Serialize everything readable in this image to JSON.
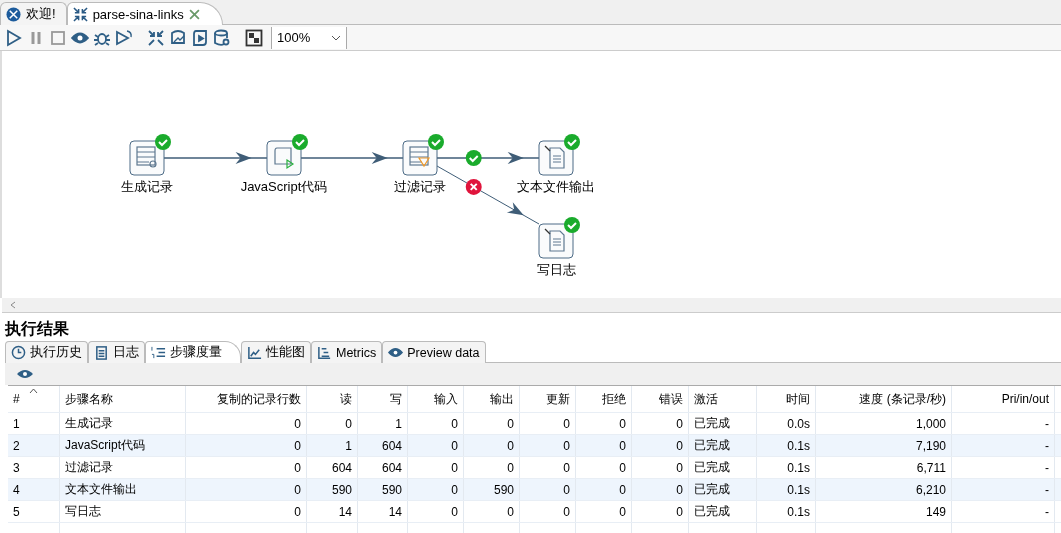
{
  "editor_tabs": [
    {
      "label": "欢迎!",
      "selected": false,
      "closable": false
    },
    {
      "label": "parse-sina-links",
      "selected": true,
      "closable": true
    }
  ],
  "toolbar": {
    "zoom": "100%"
  },
  "canvas": {
    "steps": [
      {
        "label": "生成记录",
        "finished": true
      },
      {
        "label": "JavaScript代码",
        "finished": true
      },
      {
        "label": "过滤记录",
        "finished": true
      },
      {
        "label": "文本文件输出",
        "finished": true
      },
      {
        "label": "写日志",
        "finished": true
      }
    ],
    "hops": [
      {
        "success": false,
        "error": false
      },
      {
        "success": false,
        "error": false
      },
      {
        "success": true,
        "error": false
      },
      {
        "success": false,
        "error": true
      }
    ]
  },
  "results": {
    "title": "执行结果",
    "tabs": [
      {
        "label": "执行历史",
        "selected": false
      },
      {
        "label": "日志",
        "selected": false
      },
      {
        "label": "步骤度量",
        "selected": true
      },
      {
        "label": "性能图",
        "selected": false
      },
      {
        "label": "Metrics",
        "selected": false
      },
      {
        "label": "Preview data",
        "selected": false
      }
    ],
    "table": {
      "columns": [
        {
          "label": "#",
          "sorted": true
        },
        {
          "label": "步骤名称",
          "sorted": false
        },
        {
          "label": "复制的记录行数",
          "sorted": false
        },
        {
          "label": "读",
          "sorted": false
        },
        {
          "label": "写",
          "sorted": false
        },
        {
          "label": "输入",
          "sorted": false
        },
        {
          "label": "输出",
          "sorted": false
        },
        {
          "label": "更新",
          "sorted": false
        },
        {
          "label": "拒绝",
          "sorted": false
        },
        {
          "label": "错误",
          "sorted": false
        },
        {
          "label": "激活",
          "sorted": false
        },
        {
          "label": "时间",
          "sorted": false
        },
        {
          "label": "速度 (条记录/秒)",
          "sorted": false
        },
        {
          "label": "Pri/in/out",
          "sorted": false
        }
      ],
      "rows": [
        [
          "1",
          "生成记录",
          "0",
          "0",
          "1",
          "0",
          "0",
          "0",
          "0",
          "0",
          "已完成",
          "0.0s",
          "1,000",
          "-"
        ],
        [
          "2",
          "JavaScript代码",
          "0",
          "1",
          "604",
          "0",
          "0",
          "0",
          "0",
          "0",
          "已完成",
          "0.1s",
          "7,190",
          "-"
        ],
        [
          "3",
          "过滤记录",
          "0",
          "604",
          "604",
          "0",
          "0",
          "0",
          "0",
          "0",
          "已完成",
          "0.1s",
          "6,711",
          "-"
        ],
        [
          "4",
          "文本文件输出",
          "0",
          "590",
          "590",
          "0",
          "590",
          "0",
          "0",
          "0",
          "已完成",
          "0.1s",
          "6,210",
          "-"
        ],
        [
          "5",
          "写日志",
          "0",
          "14",
          "14",
          "0",
          "0",
          "0",
          "0",
          "0",
          "已完成",
          "0.1s",
          "149",
          "-"
        ]
      ]
    }
  }
}
